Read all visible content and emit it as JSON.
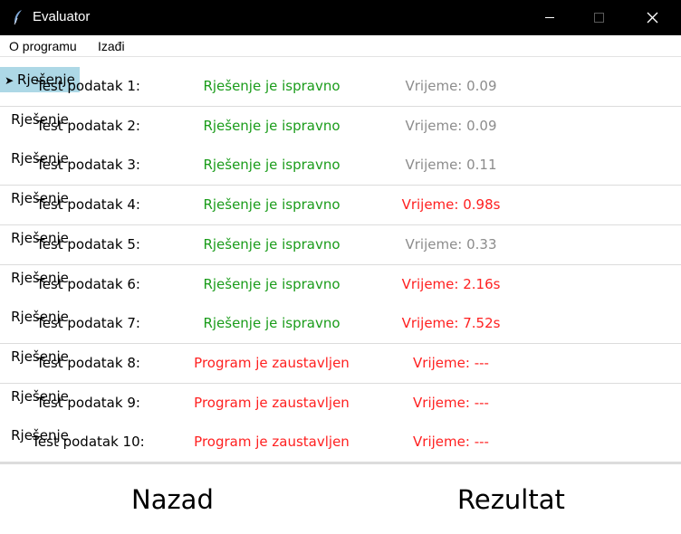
{
  "window": {
    "title": "Evaluator"
  },
  "menu": [
    {
      "label": "O programu"
    },
    {
      "label": "Izađi"
    }
  ],
  "colors": {
    "ok": "#1a9c1a",
    "error": "#ff2020",
    "neutral": "#8c8c8c",
    "focus": "#add8e6"
  },
  "rows": [
    {
      "label": "Test podatak 1:",
      "status": "Rješenje je ispravno",
      "status_kind": "ok",
      "time": "Vrijeme: 0.09",
      "time_kind": "neutral",
      "button": "Rješenje",
      "focused": true
    },
    {
      "label": "Test podatak 2:",
      "status": "Rješenje je ispravno",
      "status_kind": "ok",
      "time": "Vrijeme: 0.09",
      "time_kind": "neutral",
      "button": "Rješenje",
      "focused": false
    },
    {
      "label": "Test podatak 3:",
      "status": "Rješenje je ispravno",
      "status_kind": "ok",
      "time": "Vrijeme: 0.11",
      "time_kind": "neutral",
      "button": "Rješenje",
      "focused": false
    },
    {
      "label": "Test podatak 4:",
      "status": "Rješenje je ispravno",
      "status_kind": "ok",
      "time": "Vrijeme: 0.98s",
      "time_kind": "error",
      "button": "Rješenje",
      "focused": false
    },
    {
      "label": "Test podatak 5:",
      "status": "Rješenje je ispravno",
      "status_kind": "ok",
      "time": "Vrijeme: 0.33",
      "time_kind": "neutral",
      "button": "Rješenje",
      "focused": false
    },
    {
      "label": "Test podatak 6:",
      "status": "Rješenje je ispravno",
      "status_kind": "ok",
      "time": "Vrijeme: 2.16s",
      "time_kind": "error",
      "button": "Rješenje",
      "focused": false
    },
    {
      "label": "Test podatak 7:",
      "status": "Rješenje je ispravno",
      "status_kind": "ok",
      "time": "Vrijeme: 7.52s",
      "time_kind": "error",
      "button": "Rješenje",
      "focused": false
    },
    {
      "label": "Test podatak 8:",
      "status": "Program je zaustavljen",
      "status_kind": "error",
      "time": "Vrijeme: ---",
      "time_kind": "error",
      "button": "Rješenje",
      "focused": false
    },
    {
      "label": "Test podatak 9:",
      "status": "Program je zaustavljen",
      "status_kind": "error",
      "time": "Vrijeme: ---",
      "time_kind": "error",
      "button": "Rješenje",
      "focused": false
    },
    {
      "label": "Test podatak 10:",
      "status": "Program je zaustavljen",
      "status_kind": "error",
      "time": "Vrijeme: ---",
      "time_kind": "error",
      "button": "Rješenje",
      "focused": false
    }
  ],
  "footer": {
    "back_label": "Nazad",
    "result_label": "Rezultat"
  }
}
